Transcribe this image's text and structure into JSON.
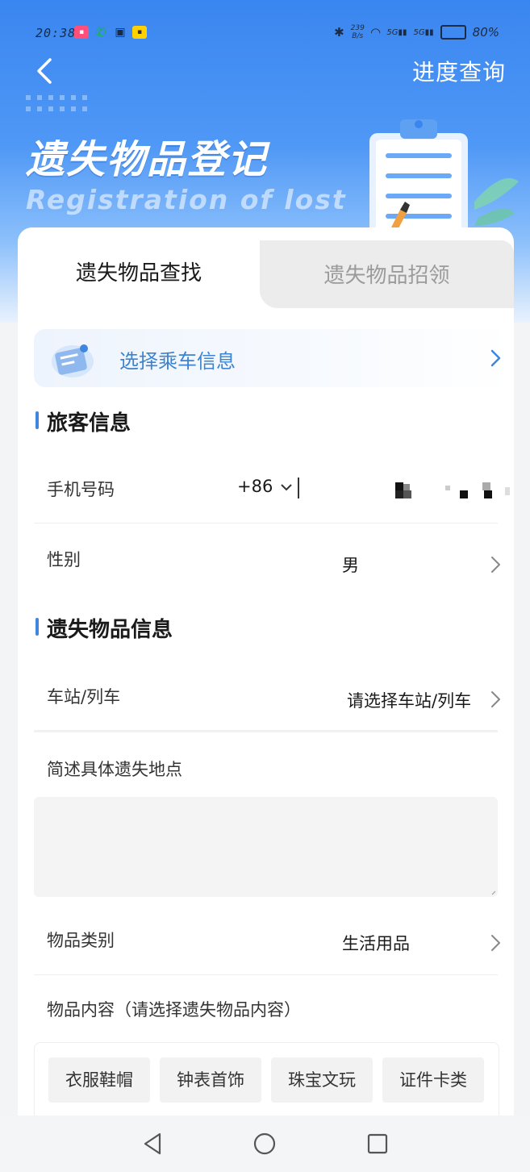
{
  "status_bar": {
    "time": "20:38",
    "speed_top": "239",
    "speed_unit": "B/s",
    "signal1": "5G",
    "signal2": "5G",
    "battery": "80%"
  },
  "header": {
    "progress_query": "进度查询",
    "title_cn": "遗失物品登记",
    "title_en": "Registration of lost"
  },
  "tabs": [
    {
      "label": "遗失物品查找",
      "active": true
    },
    {
      "label": "遗失物品招领",
      "active": false
    }
  ],
  "trip": {
    "label": "选择乘车信息"
  },
  "passenger": {
    "section_title": "旅客信息",
    "phone_label": "手机号码",
    "country_code": "+86",
    "gender_label": "性别",
    "gender_value": "男"
  },
  "item_info": {
    "section_title": "遗失物品信息",
    "station_label": "车站/列车",
    "station_value": "请选择车站/列车",
    "location_label": "简述具体遗失地点",
    "category_label": "物品类别",
    "category_value": "生活用品",
    "content_label": "物品内容（请选择遗失物品内容）",
    "chips": [
      "衣服鞋帽",
      "钟表首饰",
      "珠宝文玩",
      "证件卡类"
    ]
  },
  "colors": {
    "accent": "#3f86e0",
    "hero_top": "#3a86f0"
  }
}
